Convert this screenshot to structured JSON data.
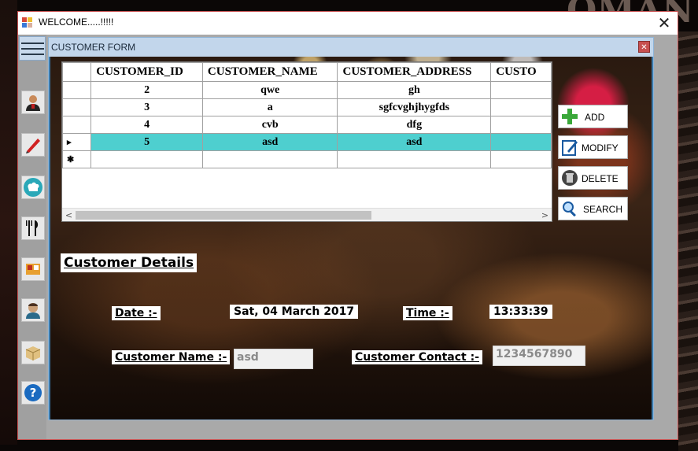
{
  "window": {
    "title": "WELCOME.....!!!!!"
  },
  "child": {
    "title": "CUSTOMER FORM"
  },
  "sidebar": {
    "icons": [
      "menu-icon",
      "user-icon",
      "pencil-icon",
      "chef-hat-icon",
      "fork-knife-icon",
      "food-icon",
      "staff-icon",
      "box-icon",
      "help-icon"
    ]
  },
  "grid": {
    "columns": [
      "CUSTOMER_ID",
      "CUSTOMER_NAME",
      "CUSTOMER_ADDRESS",
      "CUSTO"
    ],
    "rows": [
      {
        "indicator": "",
        "cells": [
          "2",
          "qwe",
          "gh",
          ""
        ]
      },
      {
        "indicator": "",
        "cells": [
          "3",
          "a",
          "sgfcvghjhygfds",
          ""
        ]
      },
      {
        "indicator": "",
        "cells": [
          "4",
          "cvb",
          "dfg",
          ""
        ]
      },
      {
        "indicator": "▸",
        "cells": [
          "5",
          "asd",
          "asd",
          ""
        ]
      },
      {
        "indicator": "✱",
        "cells": [
          "",
          "",
          "",
          ""
        ]
      }
    ]
  },
  "actions": {
    "add": "ADD",
    "modify": "MODIFY",
    "delete": "DELETE",
    "search": "SEARCH"
  },
  "details": {
    "heading": "Customer Details",
    "date_label": "Date :-",
    "date_value": "Sat, 04 March 2017",
    "time_label": "Time :-",
    "time_value": "13:33:39",
    "name_label": "Customer Name :-",
    "name_value": "asd",
    "contact_label": "Customer Contact :-",
    "contact_value": "1234567890"
  },
  "colors": {
    "selected_row": "#4ecfcf",
    "child_border": "#3b79aa",
    "close_red": "#c75050"
  }
}
